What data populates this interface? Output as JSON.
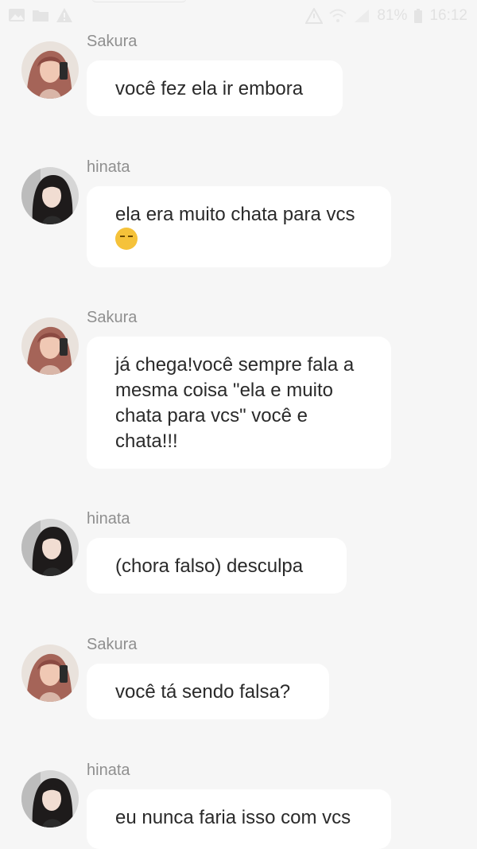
{
  "status_bar": {
    "battery": "81%",
    "time": "16:12",
    "left_icons": [
      "image-icon",
      "folder-icon",
      "warning-icon"
    ],
    "right_icons": [
      "warning-icon",
      "wifi-icon",
      "signal-icon",
      "battery-icon"
    ]
  },
  "messages": [
    {
      "sender": "Sakura",
      "text": "você fez ela ir embora",
      "avatar": "sakura-avatar"
    },
    {
      "sender": "hinata",
      "text": "ela era muito chata para vcs",
      "emoji": "unamused-face",
      "avatar": "hinata-avatar"
    },
    {
      "sender": "Sakura",
      "text": "já chega!você sempre fala a mesma coisa \"ela e muito chata para vcs\" você e chata!!!",
      "avatar": "sakura-avatar"
    },
    {
      "sender": "hinata",
      "text": "(chora falso) desculpa",
      "avatar": "hinata-avatar"
    },
    {
      "sender": "Sakura",
      "text": "você tá sendo falsa?",
      "avatar": "sakura-avatar"
    },
    {
      "sender": "hinata",
      "text": "eu nunca faria isso com vcs",
      "avatar": "hinata-avatar"
    }
  ],
  "colors": {
    "background": "#f6f6f6",
    "bubble": "#ffffff",
    "sender": "#8f8f8f",
    "text": "#2a2a2a"
  }
}
